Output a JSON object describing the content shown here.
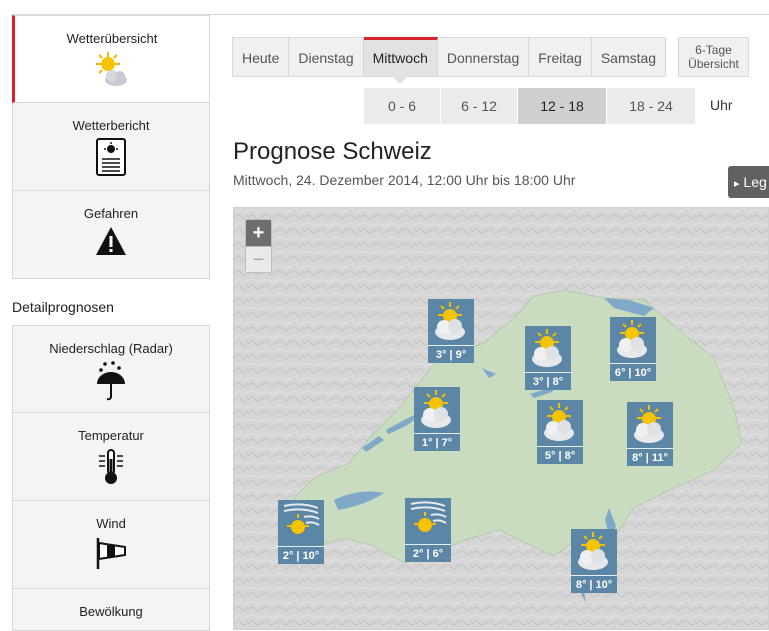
{
  "sidebar": {
    "items": [
      {
        "label": "Wetterübersicht",
        "icon": "sun-cloud-icon"
      },
      {
        "label": "Wetterbericht",
        "icon": "report-icon"
      },
      {
        "label": "Gefahren",
        "icon": "warning-icon"
      }
    ],
    "detail_heading": "Detailprognosen",
    "detail_items": [
      {
        "label": "Niederschlag (Radar)",
        "icon": "umbrella-rain-icon"
      },
      {
        "label": "Temperatur",
        "icon": "thermometer-icon"
      },
      {
        "label": "Wind",
        "icon": "windsock-icon"
      },
      {
        "label": "Bewölkung",
        "icon": "cloud-icon"
      }
    ]
  },
  "day_tabs": [
    "Heute",
    "Dienstag",
    "Mittwoch",
    "Donnerstag",
    "Freitag",
    "Samstag"
  ],
  "active_day": "Mittwoch",
  "six_day": {
    "line1": "6-Tage",
    "line2": "Übersicht"
  },
  "time_tabs": [
    "0 - 6",
    "6 - 12",
    "12 - 18",
    "18 - 24"
  ],
  "active_time": "12 - 18",
  "time_unit": "Uhr",
  "forecast": {
    "title": "Prognose Schweiz",
    "subtitle": "Mittwoch, 24. Dezember 2014, 12:00 Uhr bis 18:00 Uhr"
  },
  "legend_label": "Leg",
  "zoom": {
    "in": "+",
    "out": "−"
  },
  "markers": [
    {
      "temp": "3° | 9°",
      "icon": "sun-cloud-icon"
    },
    {
      "temp": "3° | 8°",
      "icon": "sun-cloud-icon"
    },
    {
      "temp": "6° | 10°",
      "icon": "sun-cloud-icon"
    },
    {
      "temp": "1° | 7°",
      "icon": "sun-cloud-icon"
    },
    {
      "temp": "5° | 8°",
      "icon": "sun-cloud-icon"
    },
    {
      "temp": "8° | 11°",
      "icon": "sun-cloud-icon"
    },
    {
      "temp": "2° | 10°",
      "icon": "sun-fog-icon"
    },
    {
      "temp": "2° | 6°",
      "icon": "sun-fog-icon"
    },
    {
      "temp": "8° | 10°",
      "icon": "sun-cloud-icon"
    }
  ],
  "colors": {
    "accent": "#d8232a",
    "marker": "#5b86a6",
    "land": "#c9dcc0",
    "lake": "#7fa8c9"
  }
}
